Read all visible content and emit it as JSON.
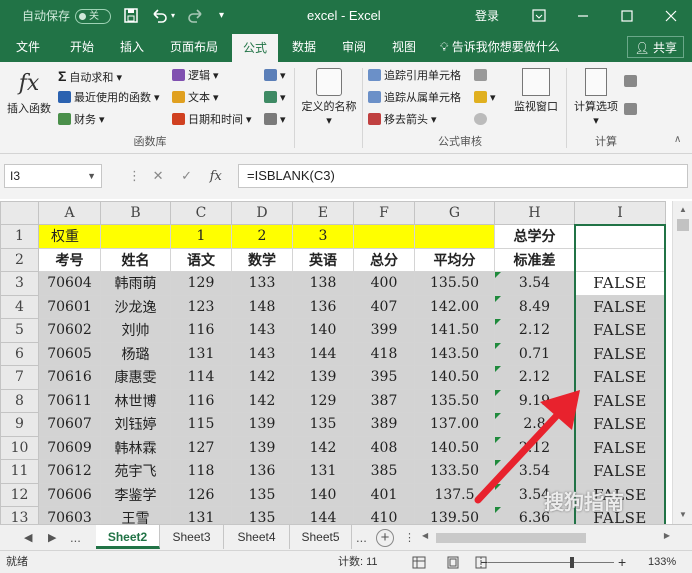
{
  "titlebar": {
    "autosave": "自动保存",
    "toggle": "关",
    "doc_title": "excel  -  Excel",
    "login": "登录",
    "save_icon": "save-icon",
    "undo_icon": "undo-icon",
    "redo_icon": "redo-icon",
    "customize_icon": "customize-quick-access-icon"
  },
  "tabs": [
    "文件",
    "开始",
    "插入",
    "页面布局",
    "公式",
    "数据",
    "审阅",
    "视图"
  ],
  "tell_me": "告诉我你想要做什么",
  "share": "共享",
  "ribbon": {
    "insert_function": "插入函数",
    "autosum": "自动求和",
    "recent": "最近使用的函数",
    "finance": "财务",
    "logic": "逻辑",
    "text": "文本",
    "datetime": "日期和时间",
    "group_library": "函数库",
    "defined_names": "定义的名称",
    "trace_precedents": "追踪引用单元格",
    "trace_dependents": "追踪从属单元格",
    "remove_arrows": "移去箭头",
    "watch_window": "监视窗口",
    "group_audit": "公式审核",
    "calc_options": "计算选项",
    "group_calc": "计算"
  },
  "formula_bar": {
    "name_box": "I3",
    "fx": "fx",
    "formula": "=ISBLANK(C3)"
  },
  "columns": [
    "A",
    "B",
    "C",
    "D",
    "E",
    "F",
    "G",
    "H",
    "I"
  ],
  "rows": [
    {
      "num": "1",
      "cells": [
        "权重",
        "",
        "1",
        "2",
        "3",
        "",
        "",
        "总学分",
        ""
      ]
    },
    {
      "num": "2",
      "cells": [
        "考号",
        "姓名",
        "语文",
        "数学",
        "英语",
        "总分",
        "平均分",
        "标准差",
        ""
      ]
    },
    {
      "num": "3",
      "cells": [
        "70604",
        "韩雨萌",
        "129",
        "133",
        "138",
        "400",
        "135.50",
        "3.54",
        "FALSE"
      ]
    },
    {
      "num": "4",
      "cells": [
        "70601",
        "沙龙逸",
        "123",
        "148",
        "136",
        "407",
        "142.00",
        "8.49",
        "FALSE"
      ]
    },
    {
      "num": "5",
      "cells": [
        "70602",
        "刘帅",
        "116",
        "143",
        "140",
        "399",
        "141.50",
        "2.12",
        "FALSE"
      ]
    },
    {
      "num": "6",
      "cells": [
        "70605",
        "杨璐",
        "131",
        "143",
        "144",
        "418",
        "143.50",
        "0.71",
        "FALSE"
      ]
    },
    {
      "num": "7",
      "cells": [
        "70616",
        "康惠雯",
        "114",
        "142",
        "139",
        "395",
        "140.50",
        "2.12",
        "FALSE"
      ]
    },
    {
      "num": "8",
      "cells": [
        "70611",
        "林世博",
        "116",
        "142",
        "129",
        "387",
        "135.50",
        "9.19",
        "FALSE"
      ]
    },
    {
      "num": "9",
      "cells": [
        "70607",
        "刘钰婷",
        "115",
        "139",
        "135",
        "389",
        "137.00",
        "2.8",
        "FALSE"
      ]
    },
    {
      "num": "10",
      "cells": [
        "70609",
        "韩林霖",
        "127",
        "139",
        "142",
        "408",
        "140.50",
        "2.12",
        "FALSE"
      ]
    },
    {
      "num": "11",
      "cells": [
        "70612",
        "苑宇飞",
        "118",
        "136",
        "131",
        "385",
        "133.50",
        "3.54",
        "FALSE"
      ]
    },
    {
      "num": "12",
      "cells": [
        "70606",
        "李鉴学",
        "126",
        "135",
        "140",
        "401",
        "137.5",
        "3.54",
        "FALSE"
      ]
    },
    {
      "num": "13",
      "cells": [
        "70603",
        "王雪",
        "131",
        "135",
        "144",
        "410",
        "139.50",
        "6.36",
        "FALSE"
      ]
    }
  ],
  "sheets": [
    "Sheet2",
    "Sheet3",
    "Sheet4",
    "Sheet5"
  ],
  "sheet_more": "...",
  "status": {
    "ready": "就绪",
    "count": "计数: 11",
    "zoom": "133%"
  },
  "watermark": "搜狗指南",
  "colors": {
    "excel_green": "#217346",
    "weight_row": "#ffff00",
    "selection": "#d3d3d3",
    "arrow": "#e8222d"
  }
}
